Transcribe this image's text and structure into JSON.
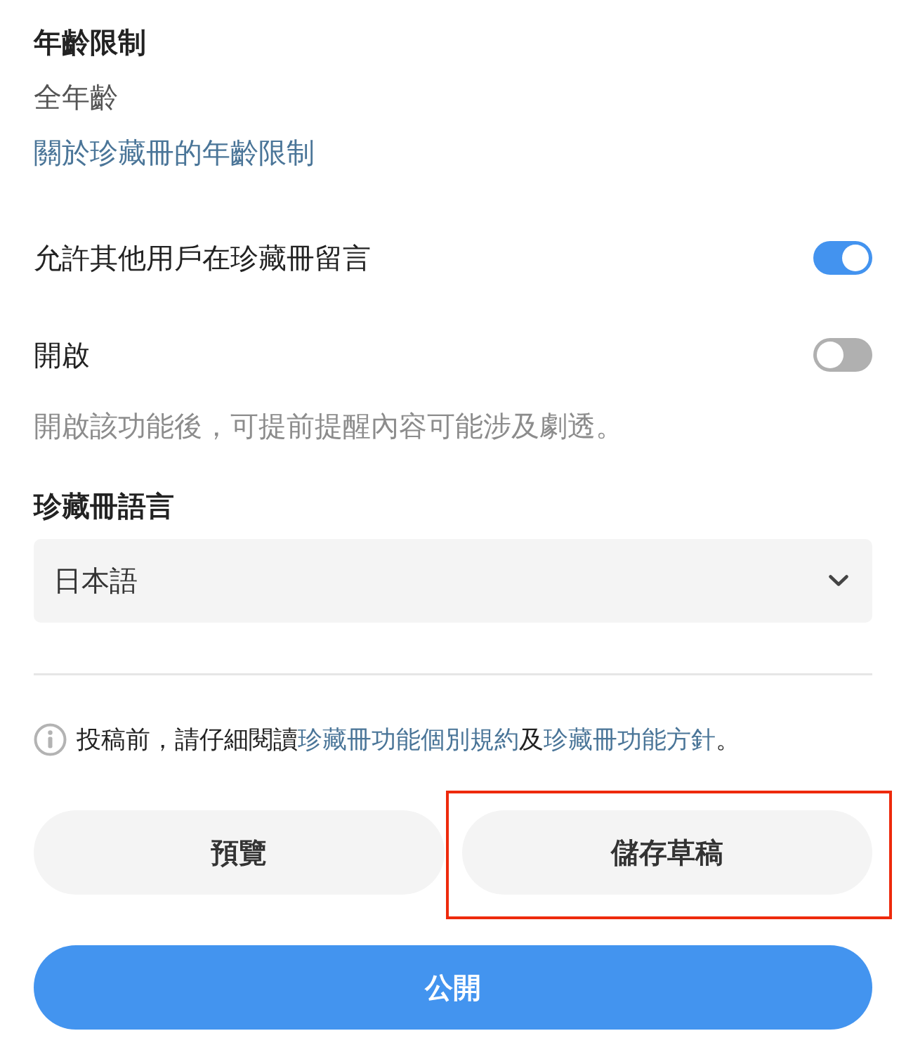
{
  "age_rating": {
    "heading": "年齡限制",
    "value": "全年齡",
    "link": "關於珍藏冊的年齡限制"
  },
  "comment_setting": {
    "label": "允許其他用戶在珍藏冊留言",
    "on": true
  },
  "spoiler_setting": {
    "label": "開啟",
    "on": false,
    "hint": "開啟該功能後，可提前提醒內容可能涉及劇透。"
  },
  "language": {
    "heading": "珍藏冊語言",
    "value": "日本語"
  },
  "notice": {
    "parts": [
      {
        "kind": "text",
        "text": "投稿前，請仔細閱讀"
      },
      {
        "kind": "link",
        "text": "珍藏冊功能個別規約"
      },
      {
        "kind": "text",
        "text": "及"
      },
      {
        "kind": "link",
        "text": "珍藏冊功能方針"
      },
      {
        "kind": "text",
        "text": "。"
      }
    ]
  },
  "buttons": [
    {
      "label": "預覽",
      "highlighted": false
    },
    {
      "label": "儲存草稿",
      "highlighted": true
    }
  ],
  "publish_button": {
    "label": "公開"
  }
}
